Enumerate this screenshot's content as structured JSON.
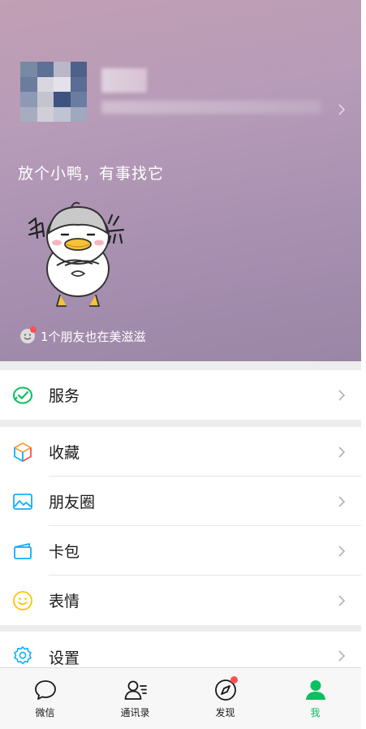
{
  "profile": {
    "status_text": "放个小鸭，有事找它",
    "friends_text": "1个朋友也在美滋滋",
    "avatar_icon": "pixelated-avatar",
    "sticker_icon": "duck-sticker-icon"
  },
  "menu": {
    "groups": [
      [
        {
          "label": "服务",
          "icon": "service-icon"
        }
      ],
      [
        {
          "label": "收藏",
          "icon": "favorites-cube-icon"
        },
        {
          "label": "朋友圈",
          "icon": "moments-image-icon"
        },
        {
          "label": "卡包",
          "icon": "card-wallet-icon"
        },
        {
          "label": "表情",
          "icon": "smiley-icon"
        }
      ],
      [
        {
          "label": "设置",
          "icon": "gear-icon"
        }
      ]
    ]
  },
  "tabs": [
    {
      "label": "微信",
      "icon": "chat-bubble-icon"
    },
    {
      "label": "通讯录",
      "icon": "contacts-icon"
    },
    {
      "label": "发现",
      "icon": "compass-icon",
      "badge": true
    },
    {
      "label": "我",
      "icon": "person-icon",
      "active": true
    }
  ],
  "colors": {
    "accent": "#07c160",
    "badge": "#fa5151",
    "header_gradient_top": "#c19fb5",
    "header_gradient_bottom": "#9a86a6"
  }
}
